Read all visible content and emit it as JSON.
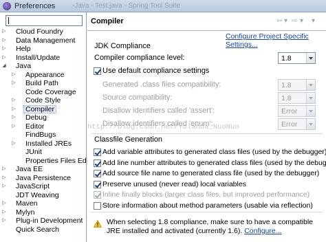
{
  "window": {
    "title": "Preferences",
    "ghost_title": "-Java - Test.java - Spring Tool Suite"
  },
  "filter": {
    "value": ""
  },
  "tree": [
    {
      "label": "Cloud Foundry",
      "level": 0,
      "twisty": "closed"
    },
    {
      "label": "Data Management",
      "level": 0,
      "twisty": "closed"
    },
    {
      "label": "Help",
      "level": 0,
      "twisty": "closed"
    },
    {
      "label": "Install/Update",
      "level": 0,
      "twisty": "closed"
    },
    {
      "label": "Java",
      "level": 0,
      "twisty": "open"
    },
    {
      "label": "Appearance",
      "level": 1,
      "twisty": "closed"
    },
    {
      "label": "Build Path",
      "level": 1,
      "twisty": "closed"
    },
    {
      "label": "Code Coverage",
      "level": 1,
      "twisty": "none"
    },
    {
      "label": "Code Style",
      "level": 1,
      "twisty": "closed"
    },
    {
      "label": "Compiler",
      "level": 1,
      "twisty": "closed",
      "selected": true
    },
    {
      "label": "Debug",
      "level": 1,
      "twisty": "closed"
    },
    {
      "label": "Editor",
      "level": 1,
      "twisty": "closed"
    },
    {
      "label": "FindBugs",
      "level": 1,
      "twisty": "none"
    },
    {
      "label": "Installed JREs",
      "level": 1,
      "twisty": "closed"
    },
    {
      "label": "JUnit",
      "level": 1,
      "twisty": "none"
    },
    {
      "label": "Properties Files Ed",
      "level": 1,
      "twisty": "none"
    },
    {
      "label": "Java EE",
      "level": 0,
      "twisty": "closed"
    },
    {
      "label": "Java Persistence",
      "level": 0,
      "twisty": "closed"
    },
    {
      "label": "JavaScript",
      "level": 0,
      "twisty": "closed"
    },
    {
      "label": "JDT Weaving",
      "level": 0,
      "twisty": "none"
    },
    {
      "label": "Maven",
      "level": 0,
      "twisty": "closed"
    },
    {
      "label": "Mylyn",
      "level": 0,
      "twisty": "closed"
    },
    {
      "label": "Plug-in Development",
      "level": 0,
      "twisty": "closed"
    },
    {
      "label": "Quick Search",
      "level": 0,
      "twisty": "none"
    }
  ],
  "page": {
    "title": "Compiler",
    "configure_link": "Configure Project Specific Settings..."
  },
  "jdk": {
    "section_title": "JDK Compliance",
    "compliance_label": "Compiler compliance level:",
    "compliance_value": "1.8",
    "use_default_label": "Use default compliance settings",
    "use_default_checked": true,
    "settings": [
      {
        "label": "Generated .class files compatibility:",
        "value": "1.8"
      },
      {
        "label": "Source compatibility:",
        "value": "1.8"
      },
      {
        "label": "Disallow identifiers called 'assert':",
        "value": "Error"
      },
      {
        "label": "Disallow identifiers called 'enum':",
        "value": "Error"
      }
    ]
  },
  "watermark": "http://blog.csdn.net/Yolanda_NuoNuo",
  "classfile": {
    "section_title": "Classfile Generation",
    "options": [
      {
        "label": "Add variable attributes to generated class files (used by the debugger)",
        "checked": true,
        "enabled": true
      },
      {
        "label": "Add line number attributes to generated class files (used by the debugger)",
        "checked": true,
        "enabled": true
      },
      {
        "label": "Add source file name to generated class file (used by the debugger)",
        "checked": true,
        "enabled": true
      },
      {
        "label": "Preserve unused (never read) local variables",
        "checked": true,
        "enabled": true
      },
      {
        "label": "Inline finally blocks (larger class files, but improved performance)",
        "checked": true,
        "enabled": false
      },
      {
        "label": "Store information about method parameters (usable via reflection)",
        "checked": false,
        "enabled": true
      }
    ]
  },
  "warning": {
    "text": "When selecting 1.8 compliance, make sure to have a compatible JRE installed and activated (currently 1.6).",
    "link": "Configure..."
  },
  "colors": {
    "link": "#1346a8",
    "selection": "#e3ecf8",
    "warning": "#f0c419"
  }
}
